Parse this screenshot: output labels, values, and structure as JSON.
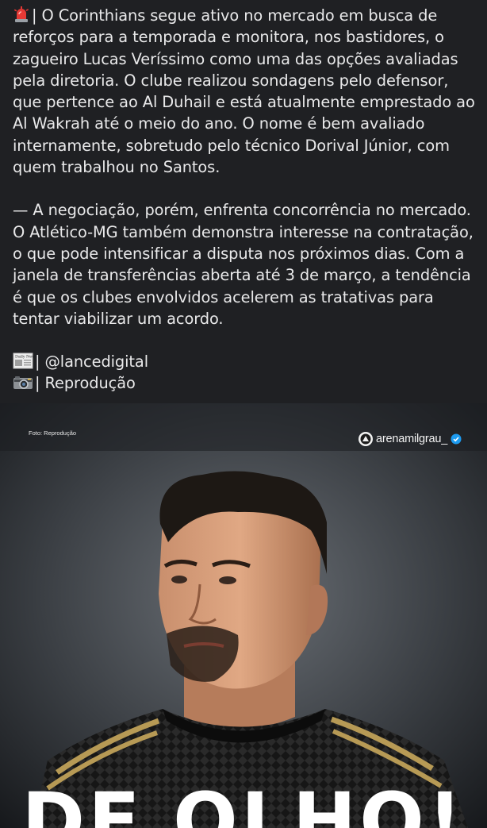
{
  "post": {
    "paragraph1": "| O Corinthians segue ativo no mercado em busca de reforços para a temporada e monitora, nos bastidores, o zagueiro Lucas Veríssimo como uma das opções avaliadas pela diretoria. O clube realizou sondagens pelo defensor, que pertence ao Al Duhail e está atualmente emprestado ao Al Wakrah até o meio do ano. O nome é bem avaliado internamente, sobretudo pelo técnico Dorival Júnior, com quem trabalhou no Santos.",
    "paragraph2": "— A negociação, porém, enfrenta concorrência no mercado. O Atlético-MG também demonstra interesse na contratação, o que pode intensificar a disputa nos próximos dias. Com a janela de transferências aberta até 3 de março, a tendência é que os clubes envolvidos acelerem as tratativas para tentar viabilizar um acordo.",
    "source_line": "| @lancedigital",
    "photo_line": "| Reprodução",
    "icons": {
      "lead": "police-siren-icon",
      "source": "newspaper-icon",
      "photo": "camera-icon"
    }
  },
  "image": {
    "credit": "Foto: Reprodução",
    "handle": "arenamilgrau_",
    "headline": "DE OLHO!",
    "colors": {
      "background": "#26292d",
      "verified": "#1d9bf0",
      "jersey": "#151515",
      "stripe": "#b79a55"
    }
  }
}
